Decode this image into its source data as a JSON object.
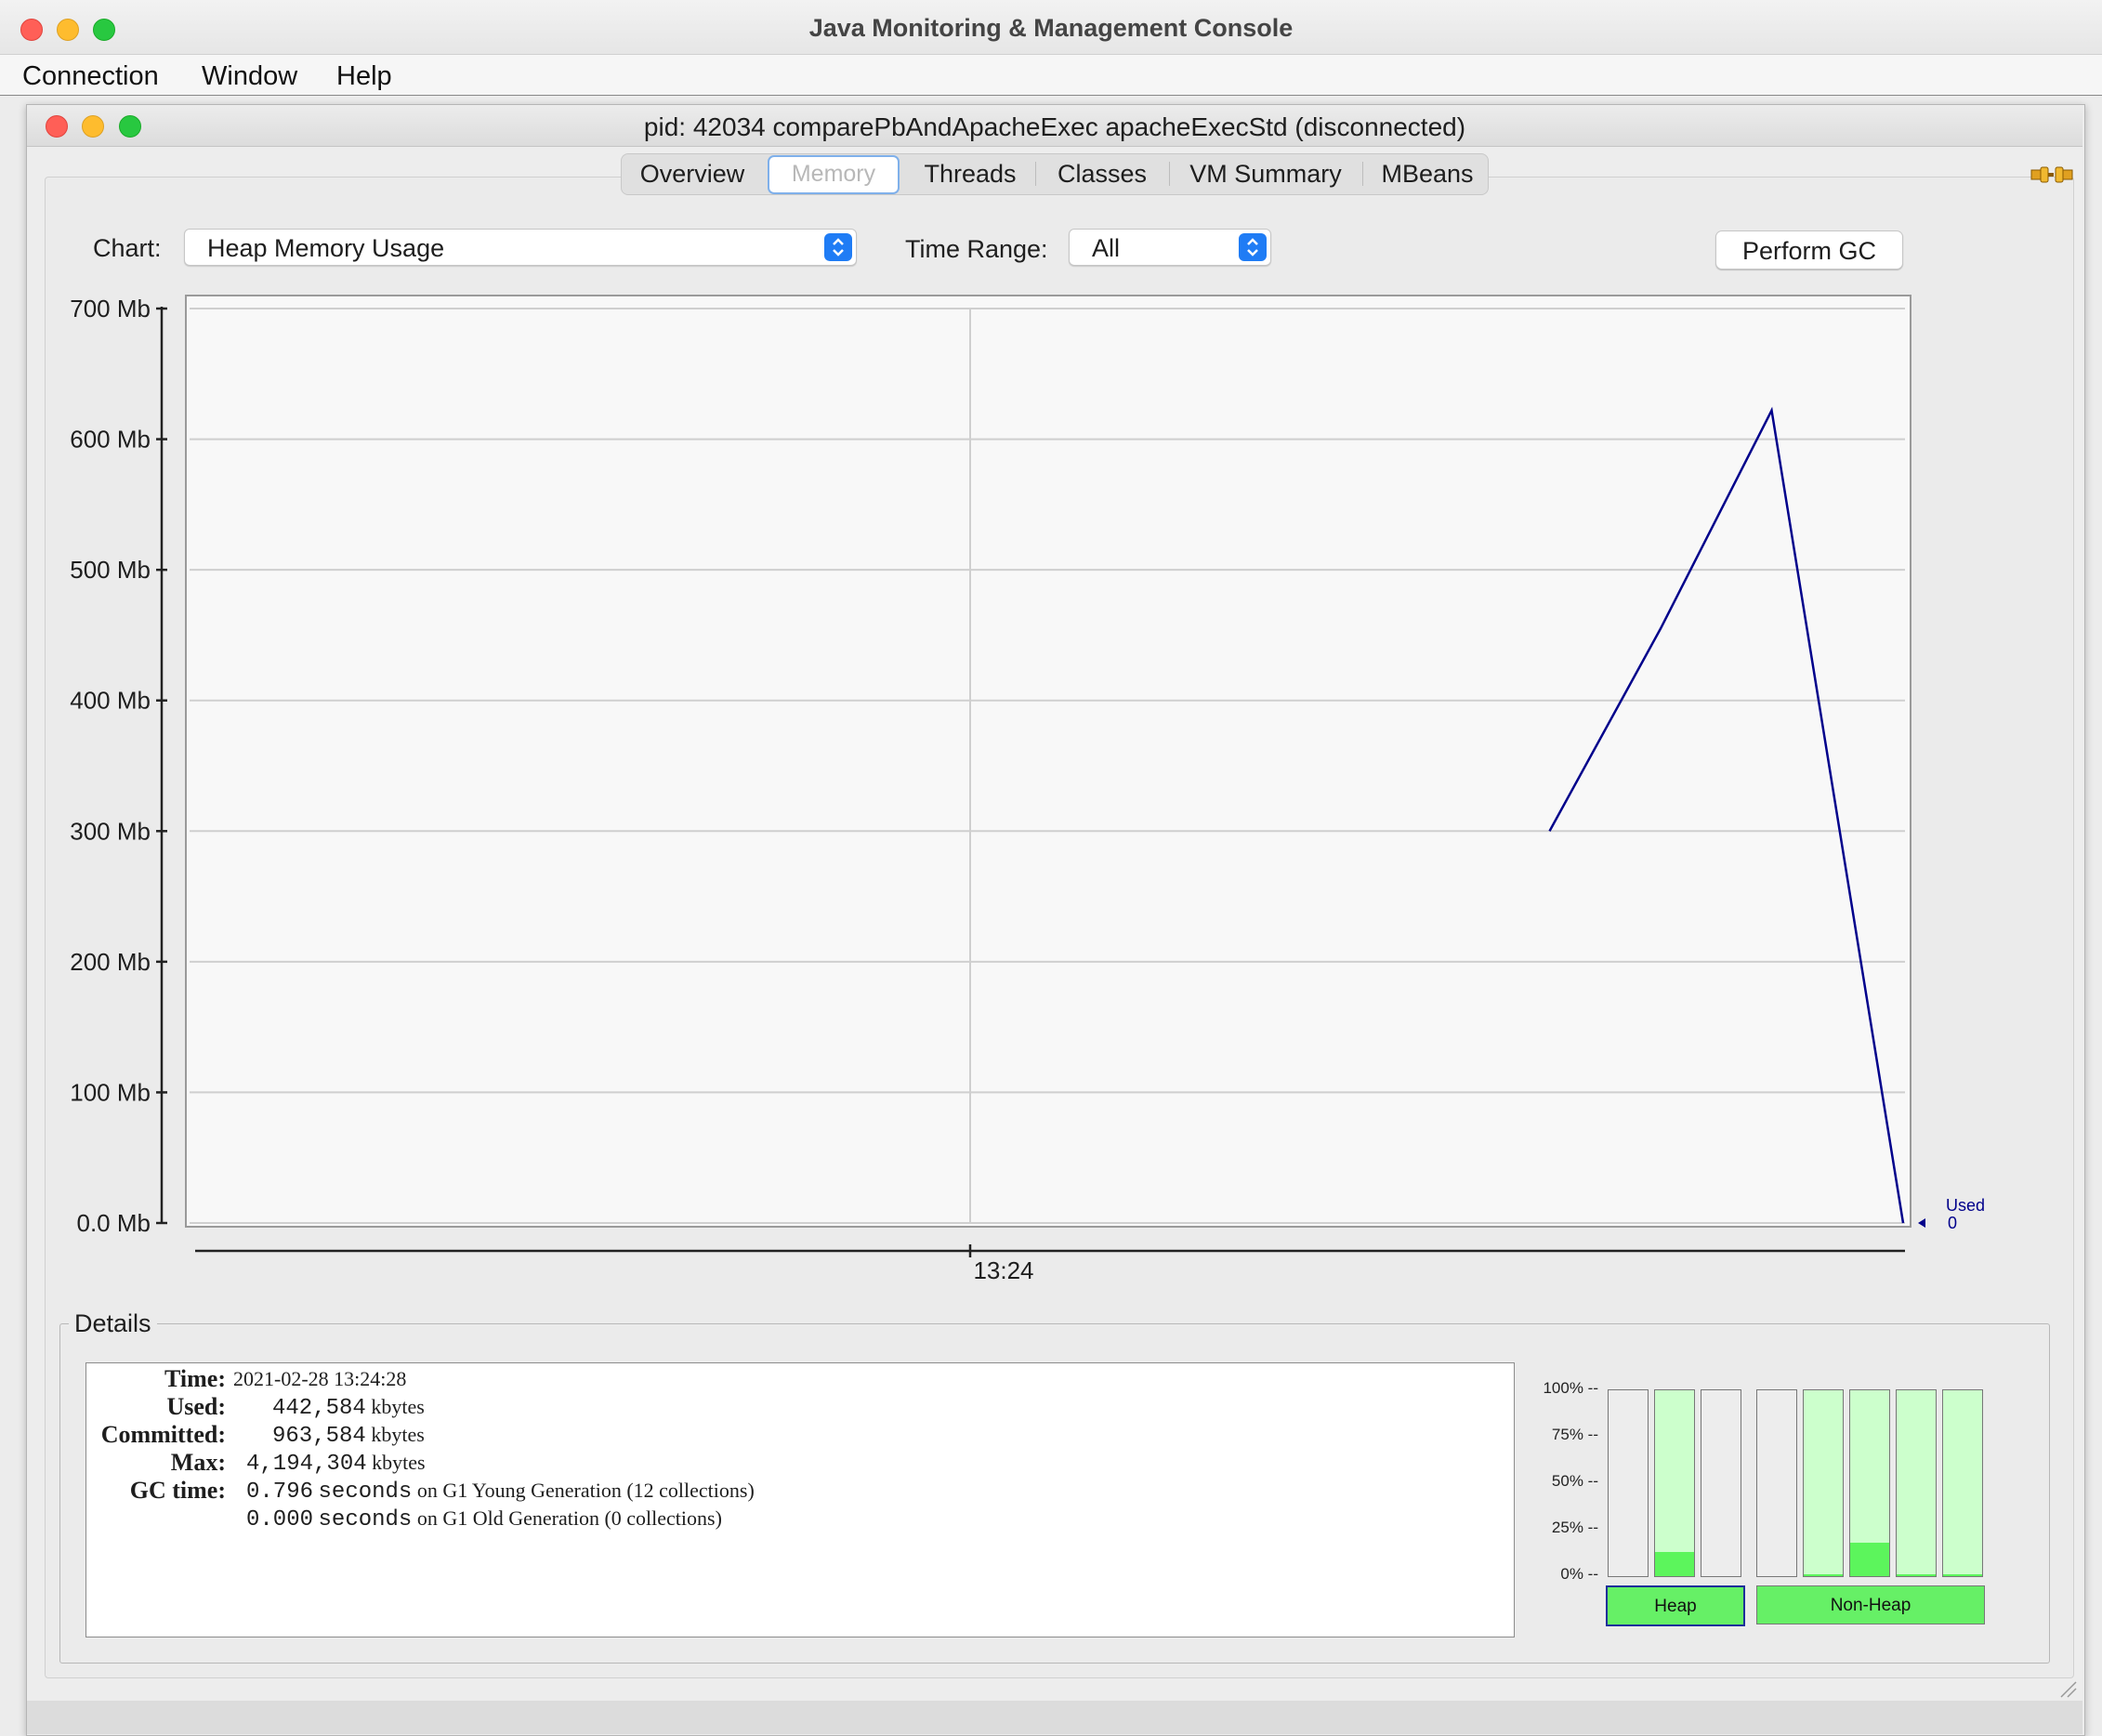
{
  "app": {
    "window_title": "Java Monitoring & Management Console",
    "menu": [
      "Connection",
      "Window",
      "Help"
    ]
  },
  "inner_window": {
    "title": "pid: 42034 comparePbAndApacheExec apacheExecStd (disconnected)"
  },
  "tabs": [
    {
      "label": "Overview",
      "selected": false
    },
    {
      "label": "Memory",
      "selected": true
    },
    {
      "label": "Threads",
      "selected": false
    },
    {
      "label": "Classes",
      "selected": false
    },
    {
      "label": "VM Summary",
      "selected": false
    },
    {
      "label": "MBeans",
      "selected": false
    }
  ],
  "controls": {
    "chart_label": "Chart:",
    "chart_value": "Heap Memory Usage",
    "time_range_label": "Time Range:",
    "time_range_value": "All",
    "perform_gc_label": "Perform GC"
  },
  "chart_data": {
    "type": "line",
    "title": "",
    "xlabel": "",
    "ylabel": "",
    "ylim": [
      0,
      700
    ],
    "y_unit": "Mb",
    "y_ticks": [
      "0.0 Mb",
      "100 Mb",
      "200 Mb",
      "300 Mb",
      "400 Mb",
      "500 Mb",
      "600 Mb",
      "700 Mb"
    ],
    "x_ticks": [
      "13:24"
    ],
    "grid": true,
    "line_color": "#00008b",
    "series": [
      {
        "name": "Used",
        "points_fraction_x": [
          0.793,
          0.858,
          0.923,
          1.0
        ],
        "values": [
          300,
          455,
          622,
          0
        ]
      }
    ],
    "end_marker": {
      "label": "Used",
      "value": "0"
    }
  },
  "details": {
    "legend": "Details",
    "time_key": "Time:",
    "time_value": "2021-02-28 13:24:28",
    "used_key": "Used:",
    "used_value": "442,584",
    "committed_key": "Committed:",
    "committed_value": "963,584",
    "max_key": "Max:",
    "max_value": "4,194,304",
    "kbytes": "kbytes",
    "gc_key": "GC time:",
    "gc_young_value": "0.796",
    "gc_young_text": "on G1 Young Generation (12 collections)",
    "gc_old_value": "0.000",
    "gc_old_text": "on G1 Old Generation (0 collections)",
    "seconds": "seconds"
  },
  "pools": {
    "pct_labels": [
      "100% --",
      "75% --",
      "50% --",
      "25% --",
      "0% --"
    ],
    "heap_label": "Heap",
    "nonheap_label": "Non-Heap",
    "heap_bars": [
      {
        "committed": 0.0,
        "used": 0.0
      },
      {
        "committed": 1.0,
        "used": 0.13
      },
      {
        "committed": 0.0,
        "used": 0.0
      }
    ],
    "nonheap_bars": [
      {
        "committed": 0.0,
        "used": 0.0
      },
      {
        "committed": 1.0,
        "used": 0.01
      },
      {
        "committed": 1.0,
        "used": 0.18
      },
      {
        "committed": 1.0,
        "used": 0.01
      },
      {
        "committed": 1.0,
        "used": 0.01
      }
    ],
    "colors": {
      "used": "#5cf55c",
      "committed": "#ccffcc",
      "empty": "#ededed"
    }
  }
}
